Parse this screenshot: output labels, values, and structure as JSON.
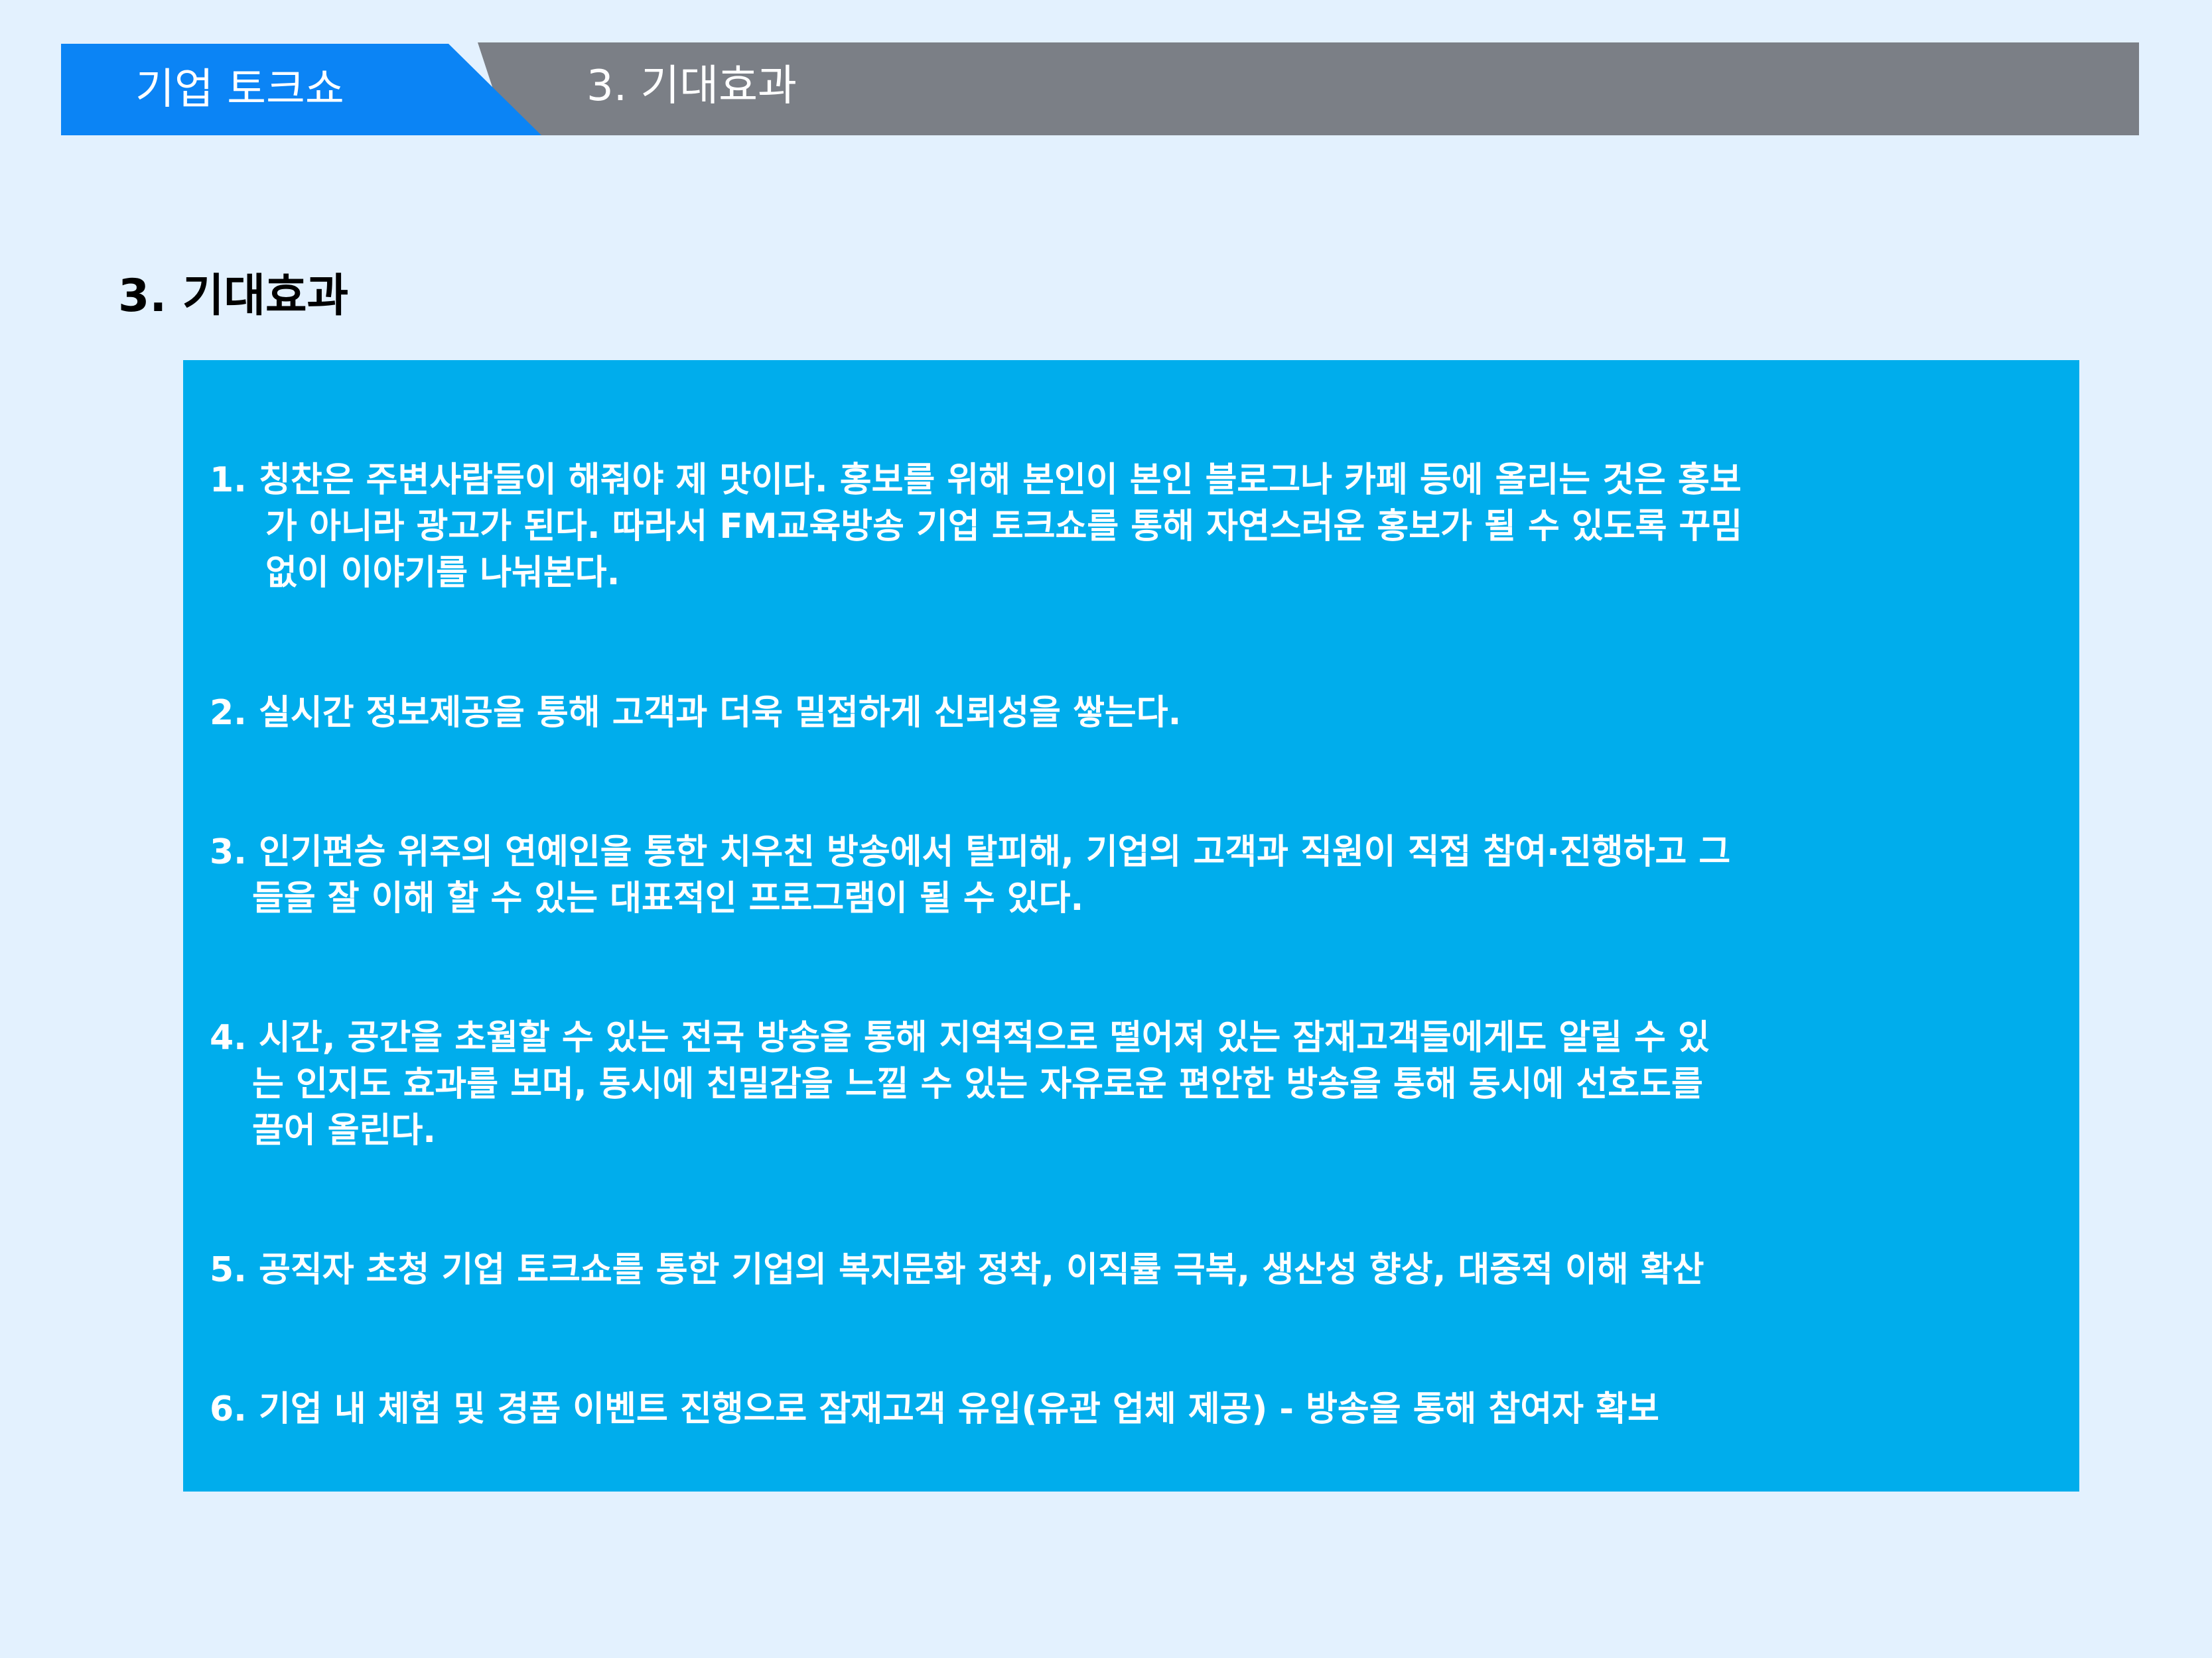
{
  "header": {
    "brand_label": "기업 토크쇼",
    "section_label": "3. 기대효과",
    "brand_color": "#0b84f5",
    "bar_color": "#7b7f86"
  },
  "page_title": "3. 기대효과",
  "content": {
    "background_color": "#00adec",
    "items": [
      {
        "lines": [
          "1. 칭찬은 주변사람들이 해줘야 제 맛이다. 홍보를 위해 본인이 본인 블로그나 카페 등에 올리는 것은 홍보",
          "가 아니라 광고가 된다. 따라서 FM교육방송 기업 토크쇼를 통해 자연스러운 홍보가 될 수 있도록 꾸밈",
          "없이 이야기를 나눠본다."
        ]
      },
      {
        "lines": [
          "2. 실시간 정보제공을 통해 고객과 더욱 밀접하게 신뢰성을 쌓는다."
        ]
      },
      {
        "lines": [
          "3. 인기편승 위주의 연예인을 통한 치우친 방송에서 탈피해, 기업의 고객과 직원이 직접 참여·진행하고 그",
          "들을 잘 이해 할 수 있는 대표적인 프로그램이 될 수 있다."
        ]
      },
      {
        "lines": [
          "4. 시간, 공간을 초월할 수 있는 전국 방송을 통해 지역적으로 떨어져 있는 잠재고객들에게도 알릴 수 있",
          "는 인지도 효과를 보며, 동시에 친밀감을 느낄 수 있는 자유로운 편안한 방송을 통해 동시에 선호도를",
          "끌어 올린다."
        ]
      },
      {
        "lines": [
          "5. 공직자 초청 기업 토크쇼를 통한 기업의 복지문화 정착, 이직률 극복, 생산성 향상, 대중적 이해 확산"
        ]
      },
      {
        "lines": [
          "6. 기업 내 체험 및 경품 이벤트 진행으로 잠재고객 유입(유관 업체 제공) - 방송을 통해 참여자 확보"
        ]
      }
    ]
  }
}
